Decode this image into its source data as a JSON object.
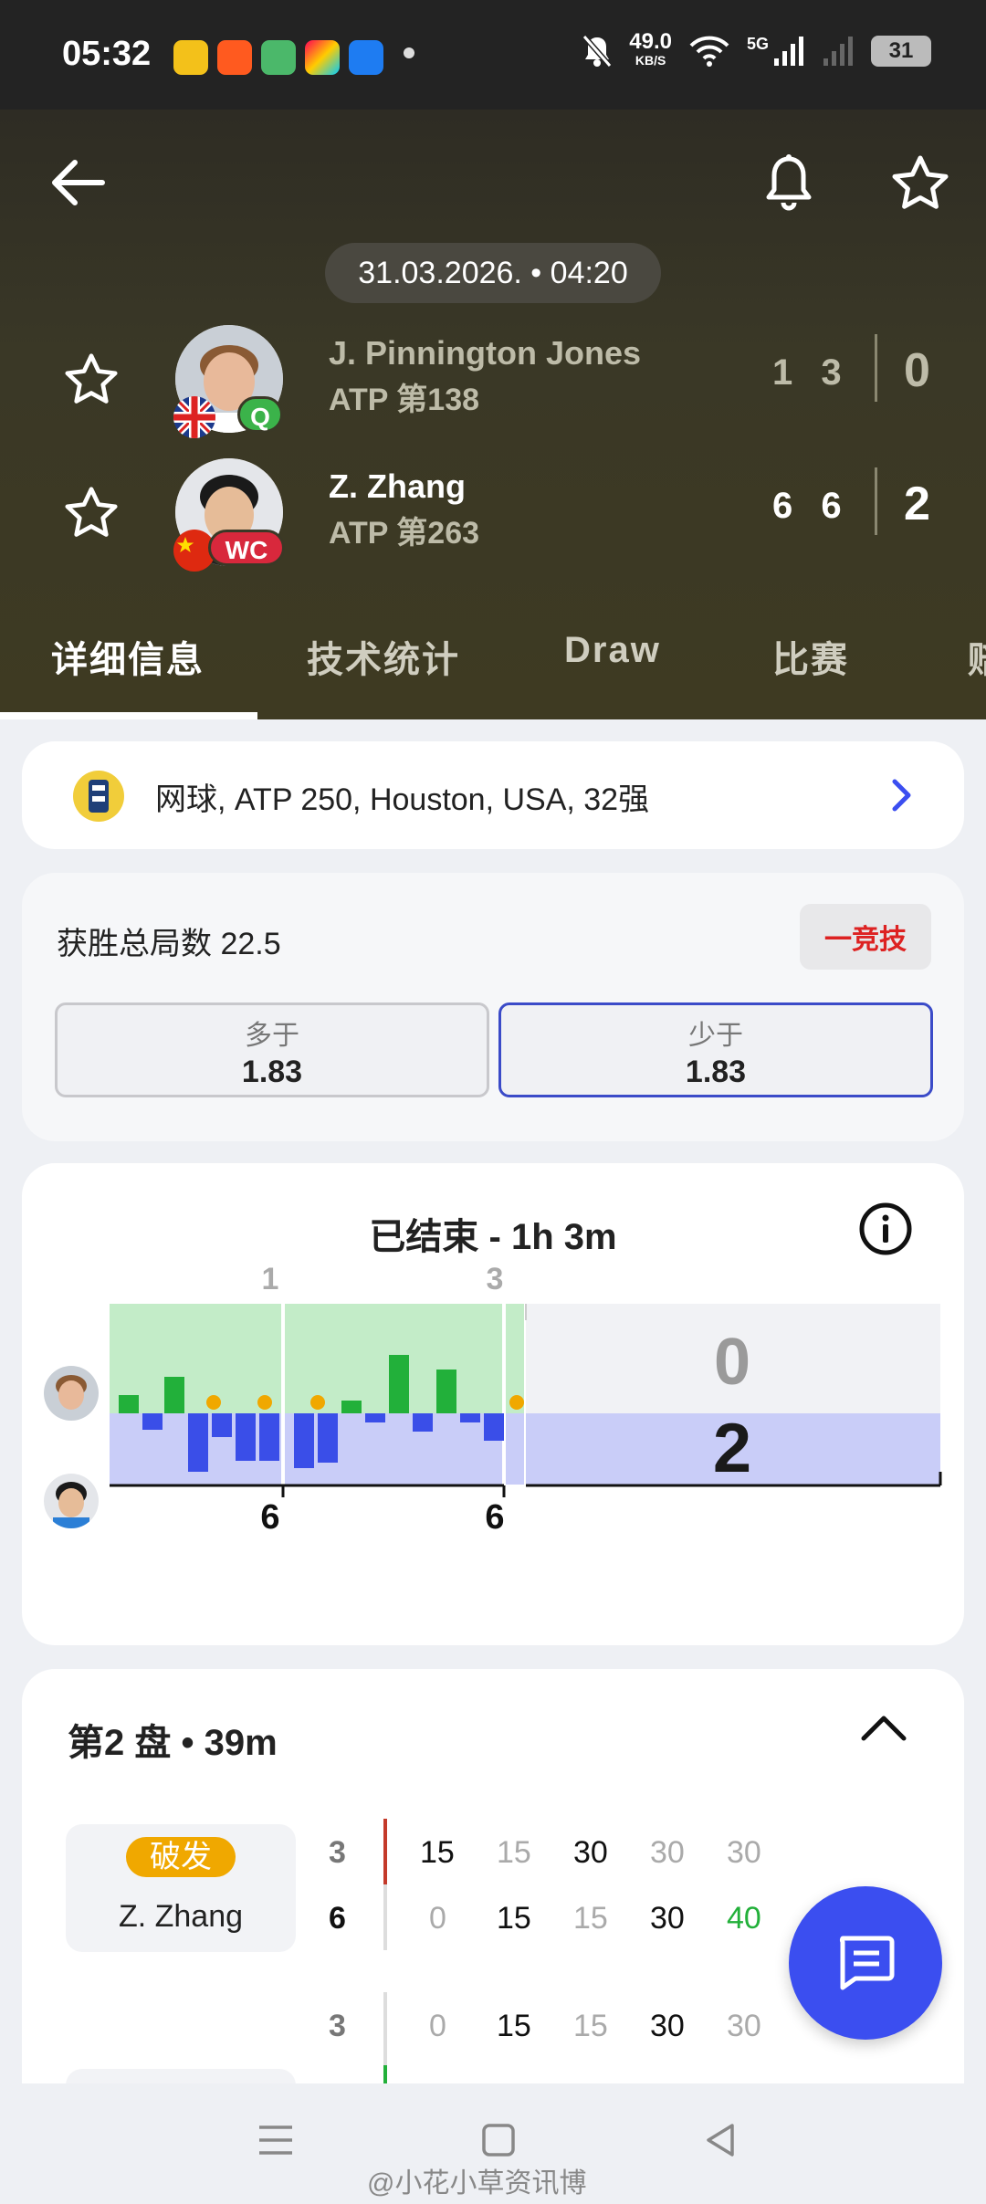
{
  "status_bar": {
    "time": "05:32",
    "net_speed_value": "49.0",
    "net_speed_unit": "KB/S",
    "network": "5G",
    "battery": "31"
  },
  "match": {
    "datetime": "31.03.2026. • 04:20"
  },
  "players": [
    {
      "name": "J. Pinnington Jones",
      "rank": "ATP 第138",
      "badge": "Q",
      "badge_color": "#3bb34a",
      "sets": "1 3",
      "total": "0",
      "flag": "gb"
    },
    {
      "name": "Z. Zhang",
      "rank": "ATP 第263",
      "badge": "WC",
      "badge_color": "#d8283c",
      "sets": "6 6",
      "total": "2",
      "flag": "cn"
    }
  ],
  "tabs": [
    {
      "label": "详细信息"
    },
    {
      "label": "技术统计"
    },
    {
      "label": "Draw"
    },
    {
      "label": "比赛"
    },
    {
      "label": "赔"
    }
  ],
  "tournament": {
    "text": "网球, ATP 250, Houston, USA, 32强"
  },
  "odds": {
    "title": "获胜总局数 22.5",
    "brand": "一竞技",
    "over_label": "多于",
    "over_value": "1.83",
    "under_label": "少于",
    "under_value": "1.83"
  },
  "momentum": {
    "title": "已结束 - 1h 3m",
    "set_markers": [
      "1",
      "3"
    ],
    "set_scores": [
      "6",
      "6"
    ],
    "score_top": "0",
    "score_bottom": "2",
    "colors": {
      "top_bg": "#c3ecc8",
      "bottom_bg": "#c9cdf8",
      "green": "#22b03a",
      "blue": "#3a4ee8",
      "serve_dot": "#f0a800"
    }
  },
  "set_detail": {
    "title": "第2 盘 • 39m",
    "rows": [
      {
        "tag": "破发",
        "player": "Z. Zhang",
        "g1": "3",
        "g2": "6",
        "top": [
          "15",
          "15",
          "30",
          "30",
          "30"
        ],
        "bottom": [
          "0",
          "15",
          "15",
          "30",
          "40"
        ]
      },
      {
        "g1": "3",
        "top": [
          "0",
          "15",
          "15",
          "30",
          "30"
        ]
      }
    ]
  },
  "watermark": "@小花小草资讯博"
}
